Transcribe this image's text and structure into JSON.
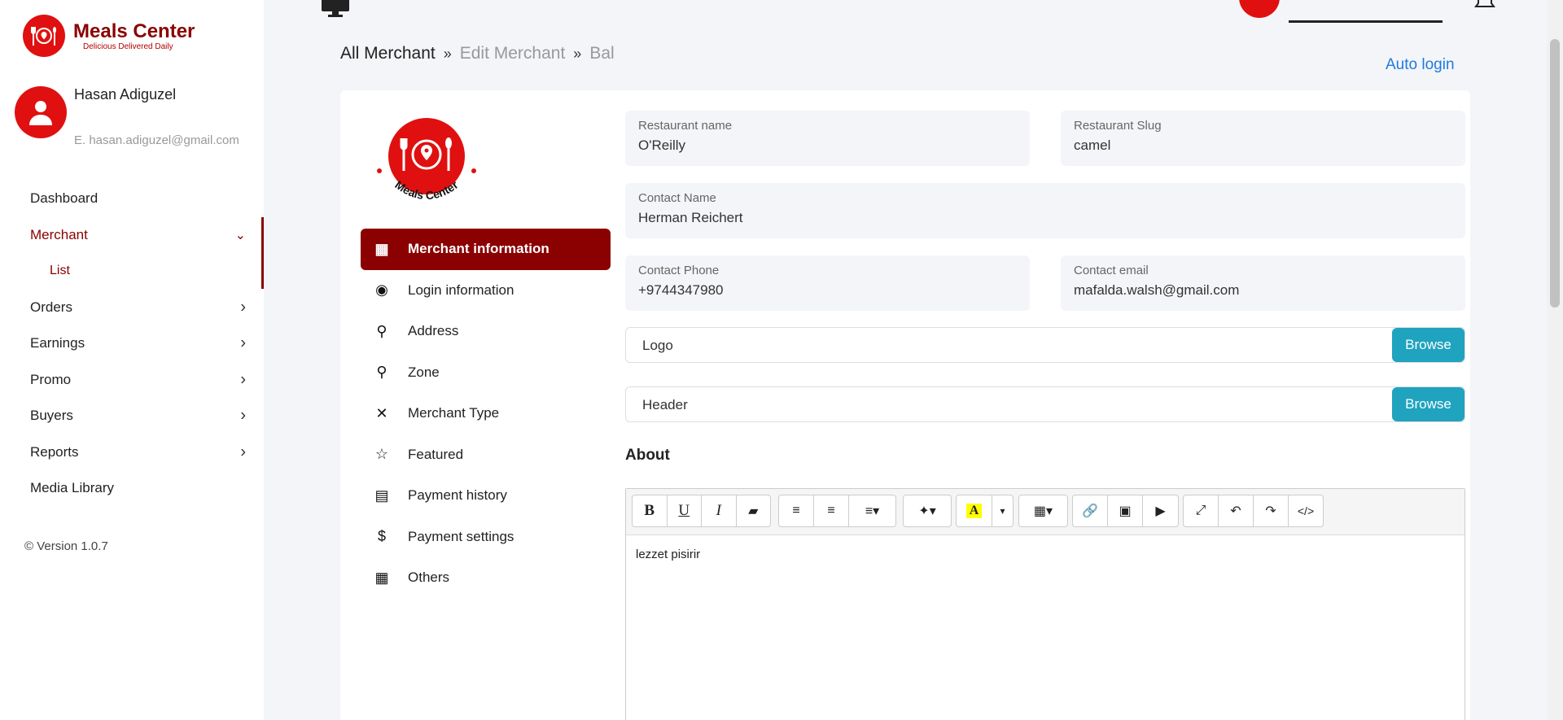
{
  "brand": {
    "name": "Meals Center",
    "tagline": "Delicious Delivered Daily"
  },
  "user": {
    "name": "Hasan Adiguzel",
    "email": "E. hasan.adiguzel@gmail.com"
  },
  "nav": {
    "dashboard": "Dashboard",
    "merchant": "Merchant",
    "list": "List",
    "orders": "Orders",
    "earnings": "Earnings",
    "promo": "Promo",
    "buyers": "Buyers",
    "reports": "Reports",
    "media": "Media Library"
  },
  "version": "© Version 1.0.7",
  "breadcrumb": {
    "root": "All Merchant",
    "mid": "Edit Merchant",
    "current": "Bal"
  },
  "auto_login": "Auto login",
  "card_logo_text": "Meals Center",
  "menu": {
    "merchant_info": "Merchant information",
    "login_info": "Login information",
    "address": "Address",
    "zone": "Zone",
    "merchant_type": "Merchant Type",
    "featured": "Featured",
    "payment_history": "Payment history",
    "payment_settings": "Payment settings",
    "others": "Others"
  },
  "form": {
    "restaurant_name": {
      "label": "Restaurant name",
      "value": "O'Reilly"
    },
    "restaurant_slug": {
      "label": "Restaurant Slug",
      "value": "camel"
    },
    "contact_name": {
      "label": "Contact Name",
      "value": "Herman Reichert"
    },
    "contact_phone": {
      "label": "Contact Phone",
      "value": "+9744347980"
    },
    "contact_email": {
      "label": "Contact email",
      "value": "mafalda.walsh@gmail.com"
    },
    "logo": "Logo",
    "header": "Header",
    "browse": "Browse",
    "about": "About",
    "about_text": "lezzet pisirir"
  },
  "colors": {
    "brand": "#8b0000",
    "brand_red": "#e01010",
    "info": "#1fa3bf",
    "link": "#1e7be0"
  }
}
